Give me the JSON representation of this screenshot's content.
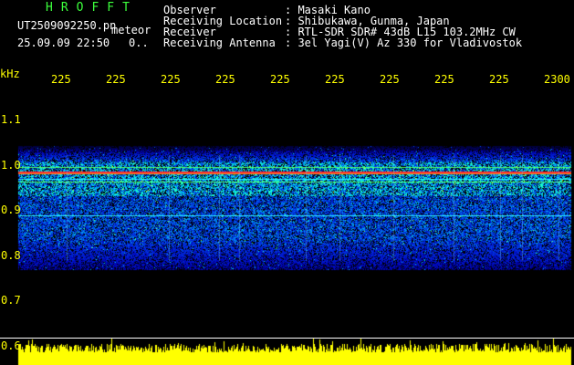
{
  "header": {
    "app_title": "HROFFT",
    "filename": "UT2509092250.pn",
    "filename_suffix": "meteor",
    "datetime": "25.09.09 22:50",
    "datetime_suffix": "0..",
    "info_labels": [
      "Observer",
      "Receiving Location",
      "Receiver",
      "Receiving Antenna"
    ],
    "info_values": [
      ": Masaki Kano",
      ": Shibukawa, Gunma, Japan",
      ": RTL-SDR SDR# 43dB L15 103.2MHz CW",
      ": 3el Yagi(V) Az 330 for Vladivostok"
    ]
  },
  "axis": {
    "unit": "kHz",
    "time_ticks": [
      "225",
      "225",
      "225",
      "225",
      "225",
      "225",
      "225",
      "225",
      "225",
      "2300"
    ],
    "freq_ticks": [
      "1.1",
      "1.0",
      "0.9",
      "0.8",
      "0.7",
      "0.6"
    ]
  },
  "colors": {
    "axis_text": "#ffff00",
    "info_text": "#ffffff",
    "title_text": "#3cff3c",
    "background": "#000000",
    "signal_line": "#ff3030",
    "noise_floor": "#1a2aa8",
    "echo_strip": "#ffff00"
  }
}
